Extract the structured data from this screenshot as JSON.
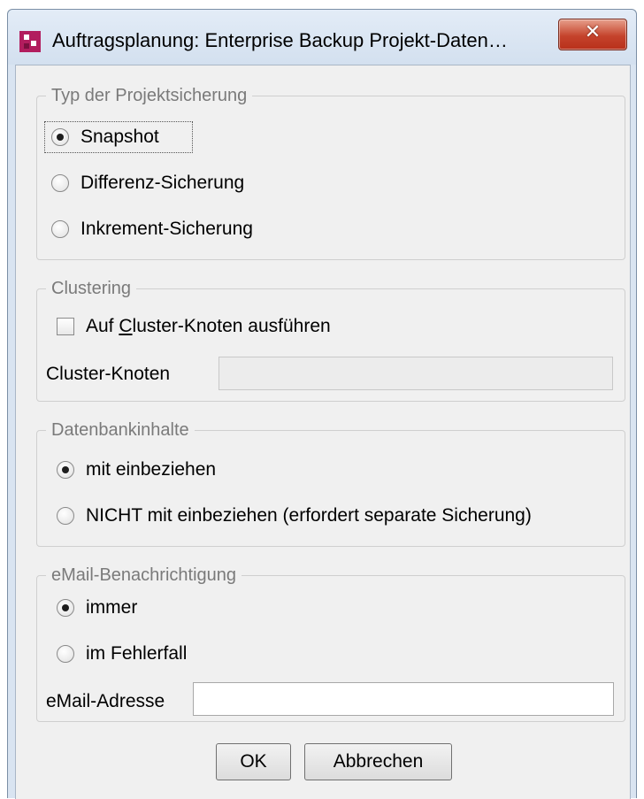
{
  "window": {
    "title": "Auftragsplanung: Enterprise Backup Projekt-Daten…",
    "close_glyph": "✕"
  },
  "backup_type": {
    "legend": "Typ der Projektsicherung",
    "options": [
      {
        "label": "Snapshot",
        "checked": true
      },
      {
        "label": "Differenz-Sicherung",
        "checked": false
      },
      {
        "label": "Inkrement-Sicherung",
        "checked": false
      }
    ]
  },
  "clustering": {
    "legend": "Clustering",
    "checkbox_prefix": "Auf ",
    "checkbox_mnemonic": "C",
    "checkbox_suffix": "luster-Knoten ausführen",
    "checkbox_checked": false,
    "node_label": "Cluster-Knoten",
    "node_value": ""
  },
  "database": {
    "legend": "Datenbankinhalte",
    "options": [
      {
        "label": "mit einbeziehen",
        "checked": true
      },
      {
        "label": "NICHT mit einbeziehen (erfordert separate Sicherung)",
        "checked": false
      }
    ]
  },
  "email": {
    "legend": "eMail-Benachrichtigung",
    "options": [
      {
        "label": "immer",
        "checked": true
      },
      {
        "label": "im Fehlerfall",
        "checked": false
      }
    ],
    "address_label": "eMail-Adresse",
    "address_value": ""
  },
  "buttons": {
    "ok": "OK",
    "cancel": "Abbrechen"
  }
}
